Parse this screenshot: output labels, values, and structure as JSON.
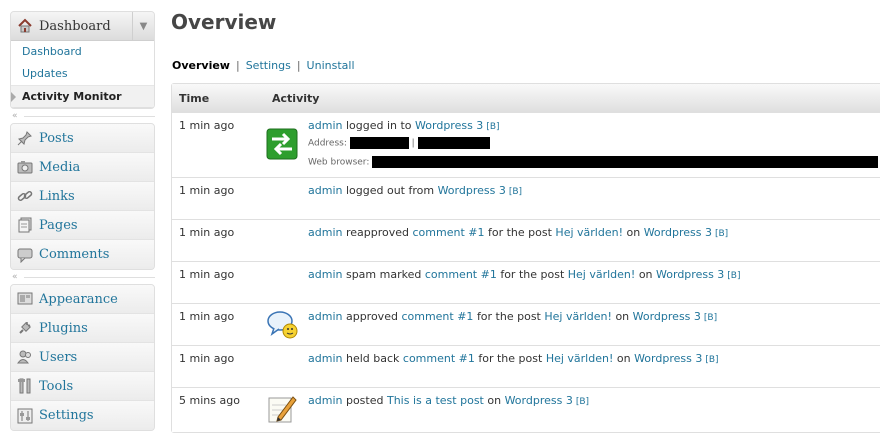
{
  "sidebar": {
    "dashboard": {
      "title": "Dashboard",
      "submenu": [
        {
          "label": "Dashboard",
          "current": false
        },
        {
          "label": "Updates",
          "current": false
        },
        {
          "label": "Activity Monitor",
          "current": true
        }
      ]
    },
    "group1": [
      {
        "label": "Posts",
        "icon": "pin-icon"
      },
      {
        "label": "Media",
        "icon": "camera-icon"
      },
      {
        "label": "Links",
        "icon": "chain-link-icon"
      },
      {
        "label": "Pages",
        "icon": "pages-icon"
      },
      {
        "label": "Comments",
        "icon": "speech-bubble-icon"
      }
    ],
    "group2": [
      {
        "label": "Appearance",
        "icon": "appearance-icon"
      },
      {
        "label": "Plugins",
        "icon": "plug-icon"
      },
      {
        "label": "Users",
        "icon": "users-icon"
      },
      {
        "label": "Tools",
        "icon": "tools-icon"
      },
      {
        "label": "Settings",
        "icon": "sliders-icon"
      }
    ]
  },
  "main": {
    "title": "Overview",
    "subnav": [
      {
        "label": "Overview",
        "current": true
      },
      {
        "label": "Settings",
        "current": false
      },
      {
        "label": "Uninstall",
        "current": false
      }
    ],
    "table": {
      "headers": {
        "time": "Time",
        "activity": "Activity"
      },
      "rows": [
        {
          "time": "1 min ago",
          "icon": "login-arrows-icon",
          "user": "admin",
          "action": "logged in to",
          "site": "Wordpress 3",
          "b": "[B]",
          "address_label": "Address:",
          "address_sep": "|",
          "browser_label": "Web browser:"
        },
        {
          "time": "1 min ago",
          "user": "admin",
          "action": "logged out from",
          "site": "Wordpress 3",
          "b": "[B]"
        },
        {
          "time": "1 min ago",
          "user": "admin",
          "action": "reapproved",
          "comment": "comment #1",
          "for_post": "for the post",
          "post": "Hej världen!",
          "on": "on",
          "site": "Wordpress 3",
          "b": "[B]"
        },
        {
          "time": "1 min ago",
          "user": "admin",
          "action": "spam marked",
          "comment": "comment #1",
          "for_post": "for the post",
          "post": "Hej världen!",
          "on": "on",
          "site": "Wordpress 3",
          "b": "[B]"
        },
        {
          "time": "1 min ago",
          "icon": "comment-smiley-icon",
          "user": "admin",
          "action": "approved",
          "comment": "comment #1",
          "for_post": "for the post",
          "post": "Hej världen!",
          "on": "on",
          "site": "Wordpress 3",
          "b": "[B]"
        },
        {
          "time": "1 min ago",
          "user": "admin",
          "action": "held back",
          "comment": "comment #1",
          "for_post": "for the post",
          "post": "Hej världen!",
          "on": "on",
          "site": "Wordpress 3",
          "b": "[B]"
        },
        {
          "time": "5 mins ago",
          "icon": "pencil-note-icon",
          "user": "admin",
          "action": "posted",
          "post": "This is a test post",
          "on": "on",
          "site": "Wordpress 3",
          "b": "[B]"
        }
      ]
    }
  },
  "colors": {
    "link": "#21759b",
    "text": "#333333",
    "border": "#dfdfdf",
    "redaction": "#000000"
  }
}
